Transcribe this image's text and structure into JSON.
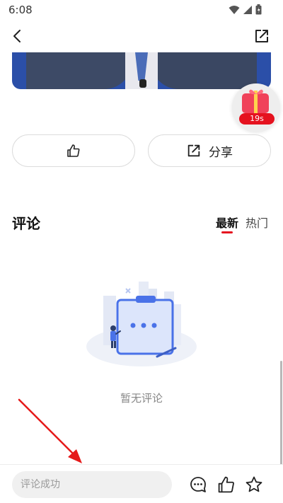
{
  "status_bar": {
    "time": "6:08",
    "icons": [
      "wifi-icon",
      "signal-icon",
      "battery-icon"
    ]
  },
  "nav": {
    "back_icon": "chevron-left-icon",
    "share_icon": "share-out-icon"
  },
  "gift": {
    "timer": "19s",
    "icon": "gift-icon"
  },
  "actions": {
    "like_icon": "thumbs-up-icon",
    "share_label": "分享",
    "share_icon": "share-out-icon"
  },
  "comments": {
    "title": "评论",
    "tabs": [
      {
        "label": "最新",
        "active": true
      },
      {
        "label": "热门",
        "active": false
      }
    ],
    "empty_text": "暂无评论"
  },
  "bottom_bar": {
    "input_placeholder": "评论成功",
    "icons": [
      "comment-icon",
      "thumbs-up-icon",
      "star-icon"
    ]
  },
  "colors": {
    "accent": "#e5121f",
    "border": "#dcdcdc",
    "input_bg": "#f0f0f0",
    "illustration_blue": "#4a72e8"
  }
}
